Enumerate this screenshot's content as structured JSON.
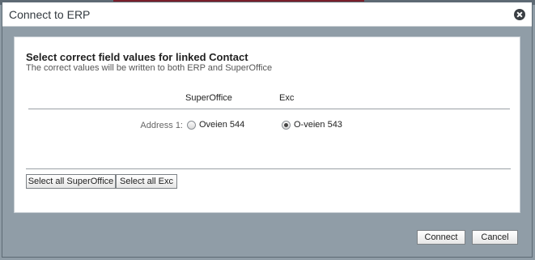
{
  "dialog": {
    "title": "Connect to ERP"
  },
  "panel": {
    "heading": "Select correct field values for linked Contact",
    "subheading": "The correct values will be written to both ERP and SuperOffice",
    "columns": {
      "superoffice": "SuperOffice",
      "exc": "Exc"
    },
    "rows": [
      {
        "label": "Address 1:",
        "superoffice_value": "Oveien 544",
        "exc_value": "O-veien 543",
        "selected": "exc"
      }
    ],
    "buttons": {
      "select_all_superoffice": "Select all SuperOffice",
      "select_all_exc": "Select all Exc"
    }
  },
  "footer": {
    "connect": "Connect",
    "cancel": "Cancel"
  },
  "icons": {
    "close": "close-icon"
  }
}
